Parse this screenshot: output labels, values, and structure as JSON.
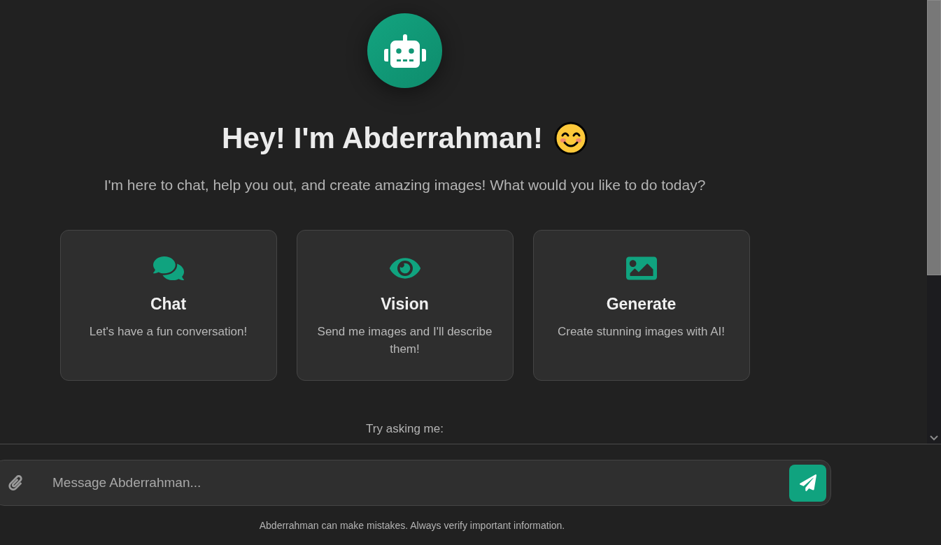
{
  "hero": {
    "title": "Hey! I'm Abderrahman!",
    "subtitle": "I'm here to chat, help you out, and create amazing images! What would you like to do today?"
  },
  "cards": [
    {
      "title": "Chat",
      "description": "Let's have a fun conversation!"
    },
    {
      "title": "Vision",
      "description": "Send me images and I'll describe them!"
    },
    {
      "title": "Generate",
      "description": "Create stunning images with AI!"
    }
  ],
  "suggestions": {
    "heading": "Try asking me:"
  },
  "composer": {
    "placeholder": "Message Abderrahman..."
  },
  "disclaimer": "Abderrahman can make mistakes. Always verify important information."
}
